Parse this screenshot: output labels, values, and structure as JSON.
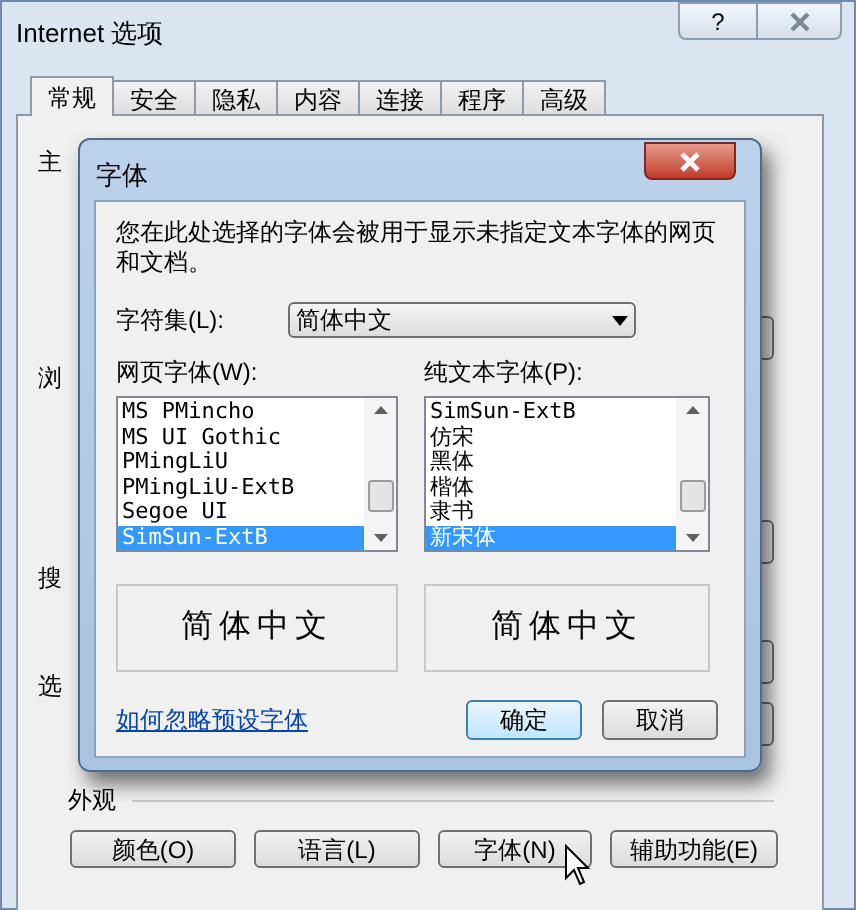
{
  "window": {
    "title": "Internet 选项",
    "help": "?"
  },
  "tabs": [
    {
      "label": "常规",
      "selected": true
    },
    {
      "label": "安全",
      "selected": false
    },
    {
      "label": "隐私",
      "selected": false
    },
    {
      "label": "内容",
      "selected": false
    },
    {
      "label": "连接",
      "selected": false
    },
    {
      "label": "程序",
      "selected": false
    },
    {
      "label": "高级",
      "selected": false
    }
  ],
  "hidden_labels": [
    "主",
    "浏",
    "搜",
    "选"
  ],
  "appearance": {
    "heading": "外观",
    "buttons": [
      "颜色(O)",
      "语言(L)",
      "字体(N)",
      "辅助功能(E)"
    ]
  },
  "dialog": {
    "title": "字体",
    "description": "您在此处选择的字体会被用于显示未指定文本字体的网页和文档。",
    "charset_label": "字符集(L):",
    "charset_value": "简体中文",
    "web_fonts": {
      "label": "网页字体(W):",
      "items": [
        {
          "text": "MS PMincho",
          "selected": false
        },
        {
          "text": "MS UI Gothic",
          "selected": false
        },
        {
          "text": "PMingLiU",
          "selected": false
        },
        {
          "text": "PMingLiU-ExtB",
          "selected": false
        },
        {
          "text": "Segoe UI",
          "selected": false
        },
        {
          "text": "SimSun-ExtB",
          "selected": true
        }
      ]
    },
    "plain_fonts": {
      "label": "纯文本字体(P):",
      "items": [
        {
          "text": "SimSun-ExtB",
          "selected": false
        },
        {
          "text": "仿宋",
          "selected": false
        },
        {
          "text": "黑体",
          "selected": false
        },
        {
          "text": "楷体",
          "selected": false
        },
        {
          "text": "隶书",
          "selected": false
        },
        {
          "text": "新宋体",
          "selected": true
        }
      ]
    },
    "previews": [
      "简体中文",
      "简体中文"
    ],
    "link": "如何忽略预设字体",
    "ok": "确定",
    "cancel": "取消"
  }
}
